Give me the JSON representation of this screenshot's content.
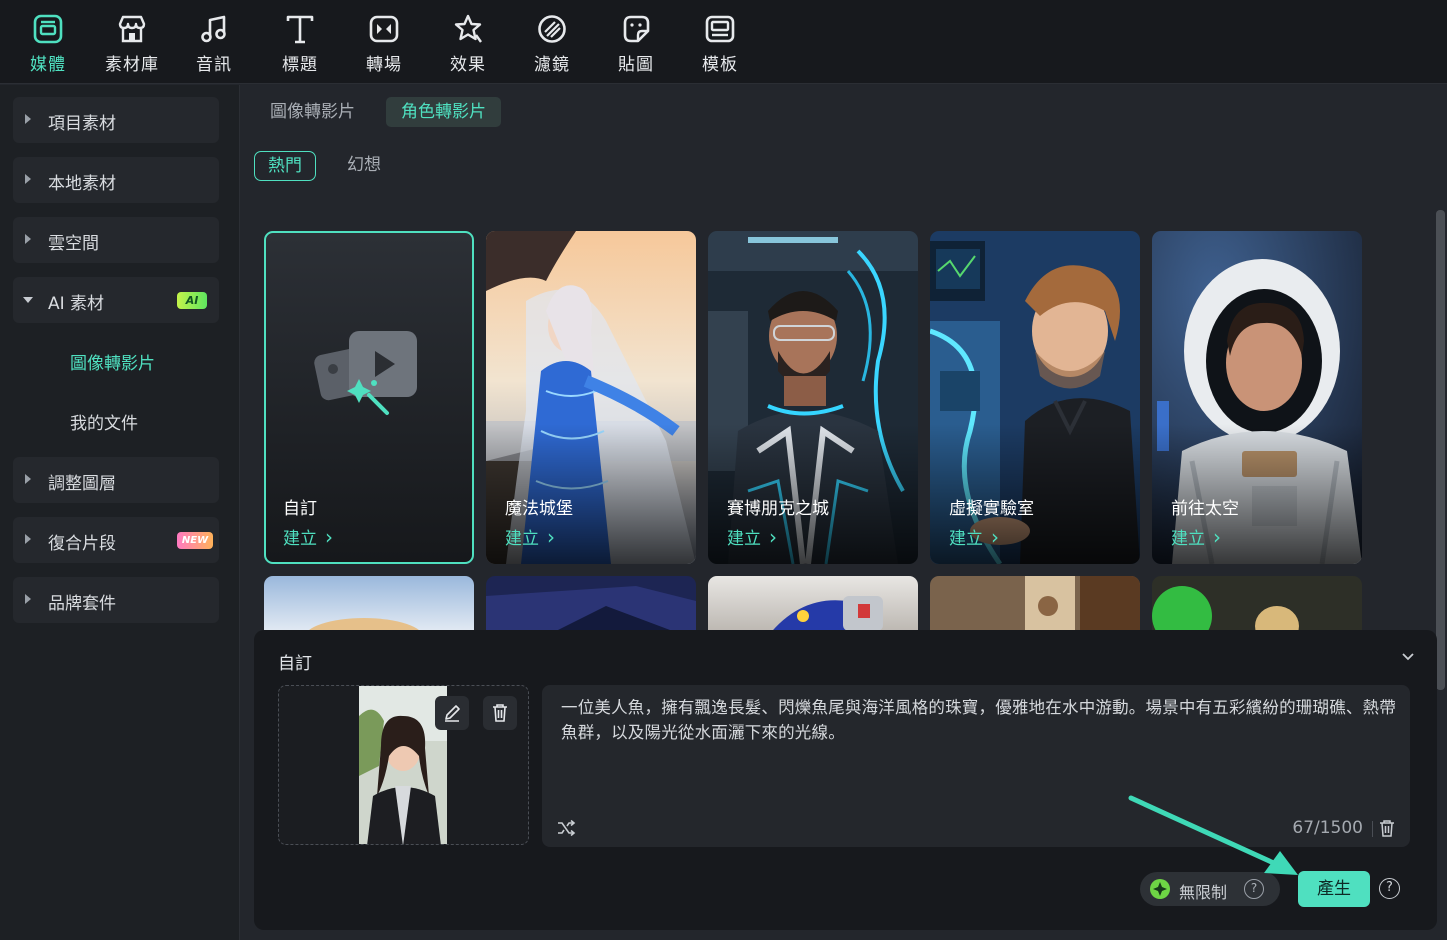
{
  "toolbar": {
    "items": [
      {
        "label": "媒體",
        "icon": "media-icon",
        "active": true
      },
      {
        "label": "素材庫",
        "icon": "library-icon"
      },
      {
        "label": "音訊",
        "icon": "music-note-icon"
      },
      {
        "label": "標題",
        "icon": "title-t-icon"
      },
      {
        "label": "轉場",
        "icon": "transition-icon"
      },
      {
        "label": "效果",
        "icon": "effect-star-icon"
      },
      {
        "label": "濾鏡",
        "icon": "filter-icon"
      },
      {
        "label": "貼圖",
        "icon": "sticker-icon"
      },
      {
        "label": "模板",
        "icon": "template-icon"
      }
    ]
  },
  "sidebar": {
    "items": [
      {
        "label": "項目素材"
      },
      {
        "label": "本地素材"
      },
      {
        "label": "雲空間"
      },
      {
        "label": "AI 素材",
        "badge": "AI",
        "open": true
      },
      {
        "label": "調整圖層"
      },
      {
        "label": "復合片段",
        "badge": "NEW"
      },
      {
        "label": "品牌套件"
      }
    ],
    "sub_items": [
      {
        "label": "圖像轉影片",
        "active": true
      },
      {
        "label": "我的文件"
      }
    ]
  },
  "main": {
    "tabs": [
      {
        "label": "圖像轉影片"
      },
      {
        "label": "角色轉影片",
        "active": true
      }
    ],
    "subtabs": [
      {
        "label": "熱門",
        "active": true
      },
      {
        "label": "幻想"
      }
    ],
    "cards": [
      {
        "name": "自訂",
        "action": "建立"
      },
      {
        "name": "魔法城堡",
        "action": "建立"
      },
      {
        "name": "賽博朋克之城",
        "action": "建立"
      },
      {
        "name": "虛擬實驗室",
        "action": "建立"
      },
      {
        "name": "前往太空",
        "action": "建立"
      }
    ]
  },
  "panel": {
    "title": "自訂",
    "prompt_text": "一位美人魚，擁有飄逸長髮、閃爍魚尾與海洋風格的珠寶，優雅地在水中游動。場景中有五彩繽紛的珊瑚礁、熱帶魚群，以及陽光從水面灑下來的光線。",
    "char_count": "67/1500",
    "unlimited_label": "無限制",
    "generate_label": "產生",
    "help_glyph": "?"
  },
  "colors": {
    "accent": "#4fe0c0",
    "background": "#23262c",
    "panel": "#17191d"
  }
}
